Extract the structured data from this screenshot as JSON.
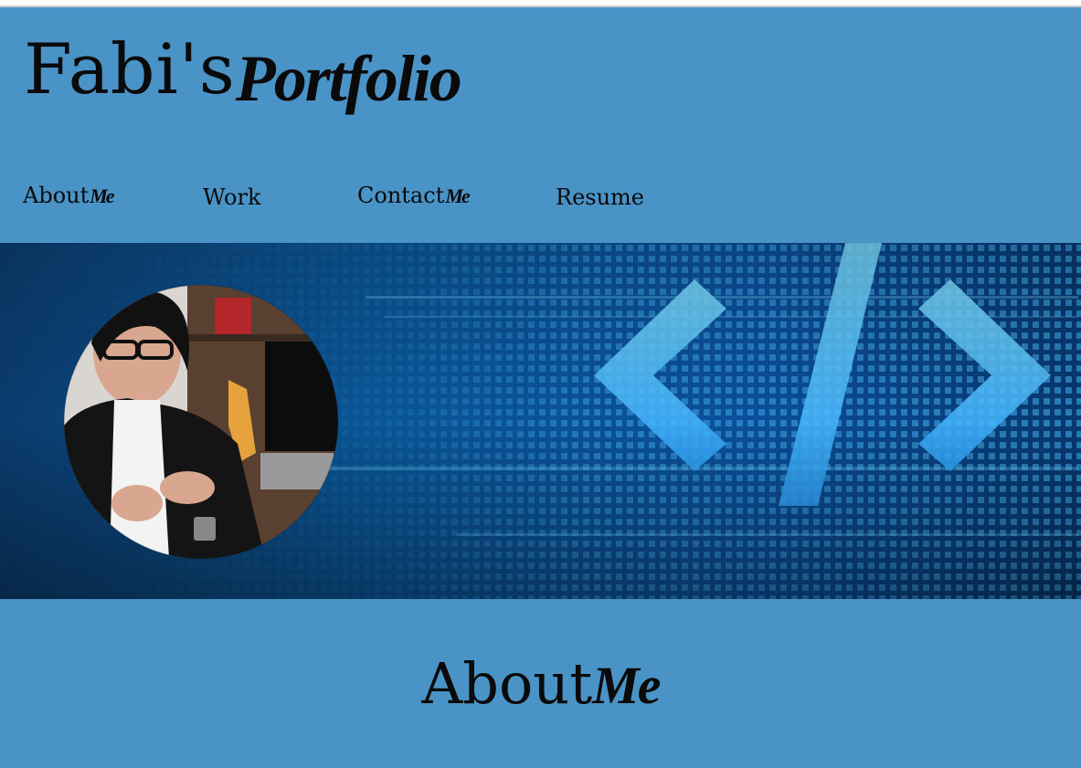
{
  "site": {
    "title_main": "Fabi's",
    "title_script": "Portfolio"
  },
  "nav": {
    "items": [
      {
        "label": "About",
        "suffix": "Me"
      },
      {
        "label": "Work",
        "suffix": ""
      },
      {
        "label": "Contact",
        "suffix": "Me"
      },
      {
        "label": "Resume",
        "suffix": ""
      }
    ]
  },
  "about": {
    "heading": "About",
    "heading_script": "Me"
  },
  "colors": {
    "page_background": "#4a93c6",
    "hero_dark": "#062a55",
    "hero_glow": "#3fb2ff"
  },
  "icons": {
    "code_symbol": "code-brackets-icon"
  }
}
